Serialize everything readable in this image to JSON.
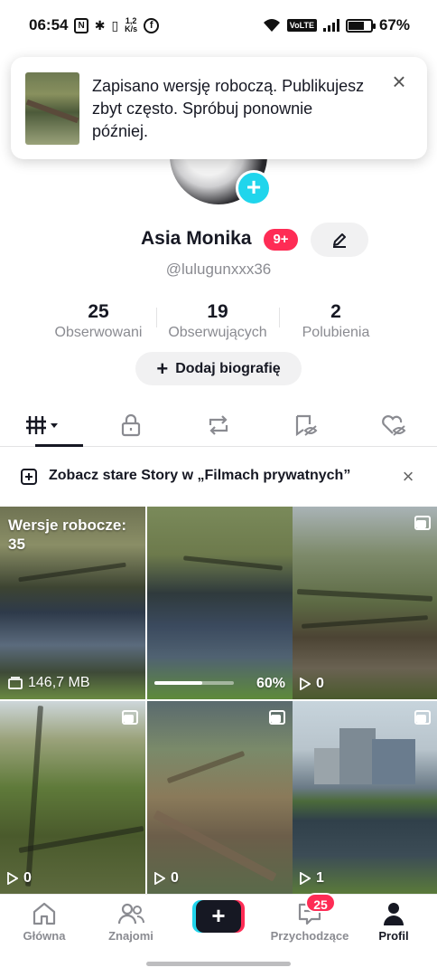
{
  "status_bar": {
    "time": "06:54",
    "net_speed": "1,2\nK/s",
    "volte": "VoLTE",
    "battery": "67%"
  },
  "toast": {
    "message": "Zapisano wersję roboczą. Publikujesz zbyt często. Spróbuj ponownie później.",
    "close_icon": "×"
  },
  "profile": {
    "display_name": "Asia Monika",
    "badge": "9+",
    "username": "@lulugunxxx36",
    "stats": [
      {
        "value": "25",
        "label": "Obserwowani"
      },
      {
        "value": "19",
        "label": "Obserwujących"
      },
      {
        "value": "2",
        "label": "Polubienia"
      }
    ],
    "bio_button": "Dodaj biografię",
    "bio_plus": "+"
  },
  "tabs": [
    "videos-grid",
    "private-lock",
    "reposts",
    "favorites",
    "liked"
  ],
  "story_banner": {
    "text": "Zobacz stare Story w „Filmach prywatnych”",
    "close": "×"
  },
  "grid": {
    "drafts": {
      "label": "Wersje robocze:",
      "count": "35",
      "size": "146,7 MB"
    },
    "uploading": {
      "progress": 0.6,
      "progress_label": "60%"
    },
    "tiles": [
      {
        "views": "0"
      },
      {
        "views": "0"
      },
      {
        "views": "0"
      },
      {
        "views": "1"
      }
    ]
  },
  "nav": {
    "home": "Główna",
    "friends": "Znajomi",
    "create": "+",
    "inbox": "Przychodzące",
    "inbox_badge": "25",
    "profile": "Profil"
  },
  "colors": {
    "accent_pink": "#fe2c55",
    "accent_cyan": "#20d5ec",
    "text": "#161823",
    "muted": "#8a8b91"
  }
}
